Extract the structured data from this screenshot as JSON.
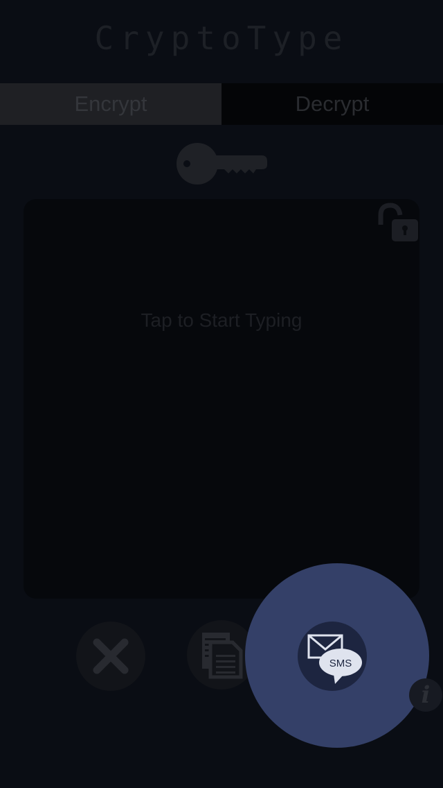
{
  "app": {
    "title": "CryptoType"
  },
  "tabs": [
    {
      "label": "Encrypt",
      "selected": true
    },
    {
      "label": "Decrypt",
      "selected": false
    }
  ],
  "editor": {
    "placeholder": "Tap to Start Typing",
    "lock_state": "unlocked"
  },
  "actions": {
    "clear_icon": "x-icon",
    "copy_icon": "copy-icon",
    "sms_icon": "sms-icon",
    "sms_label": "SMS",
    "info_label": "i"
  },
  "colors": {
    "background": "#0a0d14",
    "highlight": "#344068",
    "sms_button": "#1d2540"
  }
}
